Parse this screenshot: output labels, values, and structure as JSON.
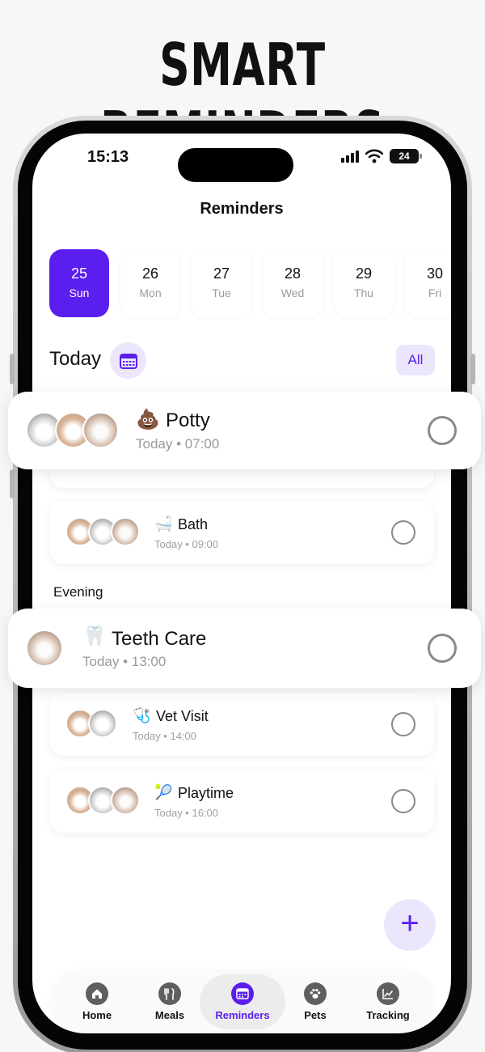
{
  "headline": "SMART REMINDERS",
  "status_bar": {
    "time": "15:13",
    "battery": "24"
  },
  "page_title": "Reminders",
  "days": [
    {
      "num": "25",
      "name": "Sun",
      "active": true
    },
    {
      "num": "26",
      "name": "Mon"
    },
    {
      "num": "27",
      "name": "Tue"
    },
    {
      "num": "28",
      "name": "Wed"
    },
    {
      "num": "29",
      "name": "Thu"
    },
    {
      "num": "30",
      "name": "Fri"
    }
  ],
  "today_label": "Today",
  "filter_label": "All",
  "evening_label": "Evening",
  "reminders": {
    "potty": {
      "emoji": "💩",
      "title": "Potty",
      "subtitle": "Today • 07:00"
    },
    "bath": {
      "emoji": "🛁",
      "title": "Bath",
      "subtitle": "Today • 09:00"
    },
    "teeth": {
      "emoji": "🦷",
      "title": "Teeth Care",
      "subtitle": "Today • 13:00"
    },
    "vet": {
      "emoji": "🩺",
      "title": "Vet Visit",
      "subtitle": "Today • 14:00"
    },
    "play": {
      "emoji": "🎾",
      "title": "Playtime",
      "subtitle": "Today • 16:00"
    }
  },
  "fab_symbol": "+",
  "tabs": [
    {
      "label": "Home",
      "icon": "home-icon"
    },
    {
      "label": "Meals",
      "icon": "fork-knife-icon"
    },
    {
      "label": "Reminders",
      "icon": "calendar-icon",
      "active": true
    },
    {
      "label": "Pets",
      "icon": "paw-icon"
    },
    {
      "label": "Tracking",
      "icon": "chart-icon"
    }
  ],
  "colors": {
    "accent": "#5a1fef",
    "accent_light": "#ece6fd",
    "muted": "#9a9a9a"
  }
}
